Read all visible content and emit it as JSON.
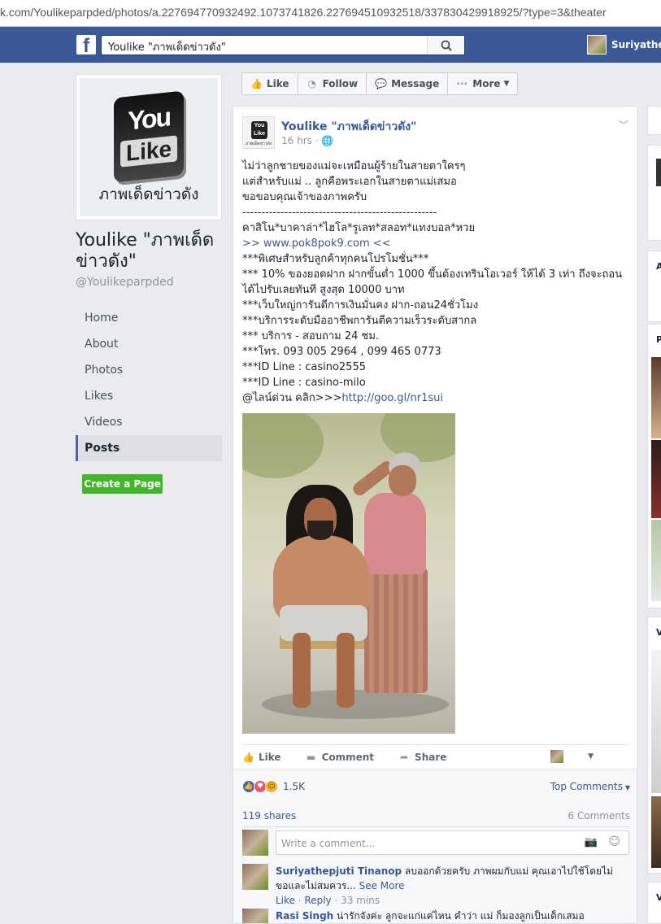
{
  "browser": {
    "url_prefix": "k.com/Youlikeparpded/photos/a.227694770932492.1073741826.227694510932518/337830429918925/?type=3&theater"
  },
  "fbbar": {
    "logo": "f",
    "search_value": "Youlike \"ภาพเด็ดข่าวดัง\"",
    "user_name": "Suriyathep"
  },
  "page": {
    "logo_you": "You",
    "logo_like": "Like",
    "logo_thai": "ภาพเด็ดข่าวดัง",
    "name": "Youlike \"ภาพเด็ดข่าวดัง\"",
    "handle": "@Youlikeparpded",
    "nav": [
      "Home",
      "About",
      "Photos",
      "Likes",
      "Videos",
      "Posts"
    ],
    "create_page": "Create a Page"
  },
  "actions": {
    "like": "Like",
    "follow": "Follow",
    "message": "Message",
    "more": "More"
  },
  "post": {
    "author": "Youlike \"ภาพเด็ดข่าวดัง\"",
    "time": "16 hrs · ",
    "text_lines": [
      "ไม่ว่าลูกชายของแม่จะเหมือนผู้ร้ายในสายตาใครๆ",
      "แต่สำหรับแม่ .. ลูกคือพระเอกในสายตาแม่เสมอ",
      "ขอขอบคุณเจ้าของภาพครับ",
      "---------------------------------------------------",
      "คาสิโน*บาคาล่า*ไฮโล*รูเลท*สลอท*แทงบอล*หวย"
    ],
    "link_prefix": ">> ",
    "link1": "www.pok8pok9.com",
    "link_suffix": " <<",
    "text_lines2": [
      "***พิเศษสำหรับลูกค้าทุกคนโปรโมชั่น***",
      "*** 10% ของยอดฝาก ฝากขั้นต่ำ 1000 ขึ้นต้องเทรินโอเวอร์ ให้ได้ 3 เท่า ถึงจะถอนได้ไปรับเลยทันที สูงสุด 10000 บาท",
      "***เว็บใหญ่การันตีการเงินมั่นคง ฝาก-ถอน24ชั่วโมง",
      "***บริการระดับมืออาชีพการันตีความเร็วระดับสากล",
      "*** บริการ - สอบถาม 24 ชม.",
      "***โทร. 093 005 2964 , 099 465 0773",
      "***ID Line : casino2555",
      "***ID Line : casino-milo"
    ],
    "last_prefix": "@ไลน์ด่วน คลิก>>>",
    "link2": "http://goo.gl/nr1sui",
    "btn_like": "Like",
    "btn_comment": "Comment",
    "btn_share": "Share",
    "reactions": "1.5K",
    "top_comments": "Top Comments",
    "shares": "119 shares",
    "comments": "6 Comments",
    "write_placeholder": "Write a comment...",
    "comment1": {
      "name": "Suriyathepjuti Tinanop",
      "text": " ลบออกด้วยครับ ภาพผมกับแม่ คุณเอาไปใช้โดยไม่ขอและไม่สมควร...",
      "more": " See More",
      "like": "Like",
      "reply": "Reply",
      "time": "33 mins"
    },
    "comment2": {
      "name": "Rasi Singh",
      "text": " น่ารักจังค่ะ ลูกจะแก่แค่ไหน คำว่า แม่ ก็มองลูกเป็นเด็กเสมอ"
    }
  },
  "right": {
    "labels": [
      "A",
      "P",
      "V",
      "V"
    ]
  }
}
